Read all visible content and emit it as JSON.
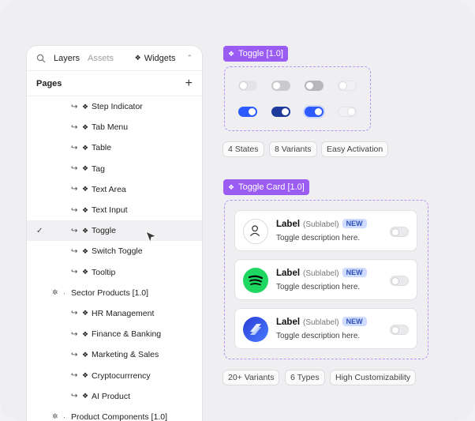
{
  "panel": {
    "tabs": {
      "layers": "Layers",
      "assets": "Assets",
      "widgets": "Widgets"
    },
    "pages_label": "Pages",
    "items": [
      {
        "label": "Step Indicator",
        "level": 2
      },
      {
        "label": "Tab Menu",
        "level": 2
      },
      {
        "label": "Table",
        "level": 2
      },
      {
        "label": "Tag",
        "level": 2
      },
      {
        "label": "Text Area",
        "level": 2
      },
      {
        "label": "Text Input",
        "level": 2
      },
      {
        "label": "Toggle",
        "level": 2,
        "selected": true
      },
      {
        "label": "Switch Toggle",
        "level": 2
      },
      {
        "label": "Tooltip",
        "level": 2
      },
      {
        "label": "Sector Products [1.0]",
        "level": 1
      },
      {
        "label": "HR Management",
        "level": 2
      },
      {
        "label": "Finance & Banking",
        "level": 2
      },
      {
        "label": "Marketing & Sales",
        "level": 2
      },
      {
        "label": "Cryptocurrrency",
        "level": 2
      },
      {
        "label": "AI Product",
        "level": 2
      },
      {
        "label": "Product Components [1.0]",
        "level": 1
      }
    ]
  },
  "toggle": {
    "title": "Toggle [1.0]",
    "tags": [
      "4 States",
      "8 Variants",
      "Easy Activation"
    ]
  },
  "toggle_card": {
    "title": "Toggle Card [1.0]",
    "cards": [
      {
        "label": "Label",
        "sublabel": "(Sublabel)",
        "badge": "NEW",
        "desc": "Toggle description here.",
        "icon": "user-icon"
      },
      {
        "label": "Label",
        "sublabel": "(Sublabel)",
        "badge": "NEW",
        "desc": "Toggle description here.",
        "icon": "spotify-icon"
      },
      {
        "label": "Label",
        "sublabel": "(Sublabel)",
        "badge": "NEW",
        "desc": "Toggle description here.",
        "icon": "app-logo-icon"
      }
    ],
    "tags": [
      "20+ Variants",
      "6 Types",
      "High Customizability"
    ]
  },
  "colors": {
    "accent": "#9b5cf3",
    "toggle_on": "#2d5bff",
    "toggle_on_dark": "#1e3a9a",
    "badge_bg": "#cfdcff"
  }
}
